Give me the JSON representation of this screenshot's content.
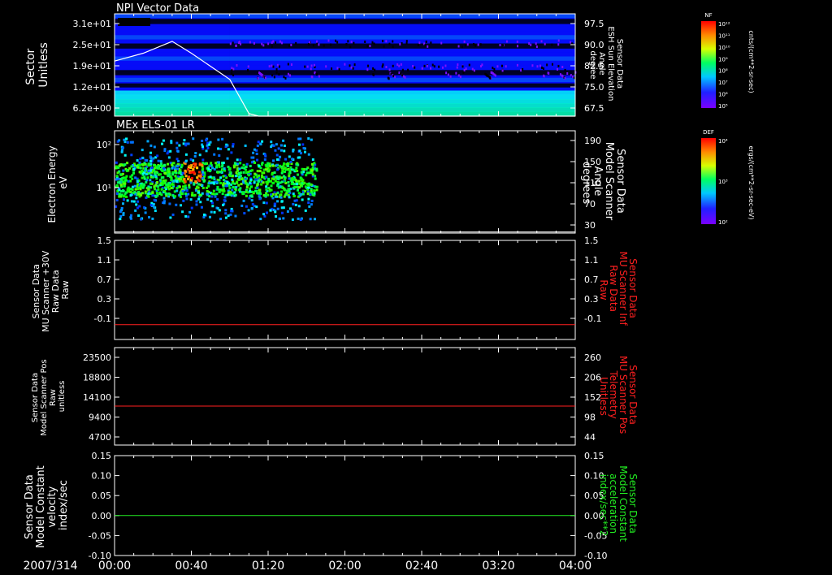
{
  "date_label": "2007/314",
  "x_axis": {
    "tick_labels": [
      "00:00",
      "00:40",
      "01:20",
      "02:00",
      "02:40",
      "03:20",
      "04:00"
    ]
  },
  "colors": {
    "frame": "#ffffff",
    "red_trace": "#ff2020",
    "green_trace": "#22ee22"
  },
  "panels": [
    {
      "title": "NPI Vector Data",
      "left_label": [
        "Sector",
        "Unitless"
      ],
      "right_label": [
        "Sensor Data",
        "ESH Sun Elevation",
        "Angle",
        "degree"
      ],
      "left_ticks": [
        "3.1e+01",
        "2.5e+01",
        "1.9e+01",
        "1.2e+01",
        "6.2e+00"
      ],
      "right_ticks": [
        "97.5",
        "90.0",
        "82.5",
        "75.0",
        "67.5"
      ],
      "colorbar": {
        "tag": "NF",
        "unit": "cnts/(cm**2-sr-sec)",
        "ticks": [
          "10¹²",
          "10¹¹",
          "10¹⁰",
          "10⁹",
          "10⁸",
          "10⁷",
          "10⁶",
          "10⁵"
        ]
      }
    },
    {
      "title": "MEx ELS-01 LR",
      "left_label": [
        "Electron Energy",
        "eV"
      ],
      "right_label": [
        "Sensor Data",
        "Model Scanner",
        "Angle",
        "degrees"
      ],
      "left_ticks": [
        "10²",
        "10¹"
      ],
      "right_ticks": [
        "190",
        "150",
        "110",
        "70",
        "30"
      ],
      "colorbar": {
        "tag": "DEF",
        "unit": "ergs/(cm**2-sr-sec-eV)",
        "ticks": [
          "10⁴",
          "10³",
          "10²"
        ]
      }
    },
    {
      "left_label": [
        "Sensor Data",
        "MU Scanner +30V",
        "Raw Data",
        "Raw"
      ],
      "right_label": [
        "Sensor Data",
        "MU Scanner Inf",
        "Raw Data",
        "Raw"
      ],
      "left_ticks": [
        "1.5",
        "1.1",
        "0.7",
        "0.3",
        "-0.1"
      ],
      "right_ticks": [
        "1.5",
        "1.1",
        "0.7",
        "0.3",
        "-0.1"
      ]
    },
    {
      "left_label": [
        "Sensor Data",
        "Model Scanner Pos",
        "Raw",
        "unitless"
      ],
      "right_label": [
        "Sensor Data",
        "MU Scanner Pos",
        "Telemetry",
        "Unitless"
      ],
      "left_ticks": [
        "23500",
        "18800",
        "14100",
        "9400",
        "4700"
      ],
      "right_ticks": [
        "260",
        "206",
        "152",
        "98",
        "44"
      ]
    },
    {
      "left_label": [
        "Sensor Data",
        "Model Constant",
        "velocity",
        "index/sec"
      ],
      "right_label": [
        "Sensor Data",
        "Model Constant",
        "acceleration",
        "index/sec**2"
      ],
      "left_ticks": [
        "0.15",
        "0.10",
        "0.05",
        "0.00",
        "-0.05",
        "-0.10"
      ],
      "right_ticks": [
        "0.15",
        "0.10",
        "0.05",
        "0.00",
        "-0.05",
        "-0.10"
      ]
    }
  ],
  "chart_data": [
    {
      "type": "heatmap",
      "title": "NPI Vector Data",
      "x_range": [
        "00:00",
        "04:00"
      ],
      "ylabel": "Sector Unitless",
      "y_ticks": [
        31,
        25,
        19,
        12,
        6.2
      ],
      "data_end_time": "01:00",
      "overlay_line": {
        "name": "ESH Sun Elevation Angle",
        "unit": "degree",
        "ylim": [
          61,
          100
        ],
        "x": [
          "00:00",
          "00:15",
          "00:30",
          "00:40",
          "01:00",
          "01:10",
          "01:15",
          "02:00",
          "03:00",
          "04:00"
        ],
        "y": [
          82.0,
          85.0,
          89.5,
          85.0,
          75.0,
          62.0,
          61.0,
          61.0,
          61.0,
          61.0
        ]
      },
      "colorbar": {
        "label": "NF",
        "unit": "cnts/(cm**2-sr-sec)",
        "range": [
          100000.0,
          1000000000000.0
        ]
      }
    },
    {
      "type": "heatmap",
      "title": "MEx ELS-01 LR",
      "x_range": [
        "00:00",
        "04:00"
      ],
      "ylabel": "Electron Energy eV",
      "y_log": true,
      "data_end_time": "01:45",
      "peak_region": {
        "time": [
          "00:35",
          "00:45"
        ],
        "energy_ev": [
          10,
          30
        ]
      },
      "overlay_line": {
        "name": "Model Scanner Angle",
        "unit": "degrees",
        "ylim": [
          10,
          190
        ],
        "x": [
          "00:00",
          "04:00"
        ],
        "y": [
          12,
          12
        ]
      },
      "colorbar": {
        "label": "DEF",
        "unit": "ergs/(cm**2-sr-sec-eV)",
        "range": [
          100,
          10000
        ]
      }
    },
    {
      "type": "line",
      "ylim": [
        -0.3,
        1.5
      ],
      "right_ylim": [
        -0.3,
        1.5
      ],
      "series": [
        {
          "name": "MU Scanner Inf Raw Data",
          "x": [
            "00:00",
            "04:00"
          ],
          "y": [
            -0.03,
            -0.03
          ],
          "color": "#ff2020"
        }
      ]
    },
    {
      "type": "line",
      "ylim": [
        0,
        23500
      ],
      "right_ylim": [
        0,
        260
      ],
      "series": [
        {
          "name": "MU Scanner Pos Telemetry",
          "x": [
            "00:00",
            "04:00"
          ],
          "y": [
            9400,
            9400
          ],
          "color": "#ff2020"
        }
      ]
    },
    {
      "type": "line",
      "ylim": [
        -0.1,
        0.15
      ],
      "right_ylim": [
        -0.1,
        0.15
      ],
      "series": [
        {
          "name": "Model Constant acceleration",
          "x": [
            "00:00",
            "04:00"
          ],
          "y": [
            0.0,
            0.0
          ],
          "color": "#22ee22"
        }
      ]
    }
  ]
}
